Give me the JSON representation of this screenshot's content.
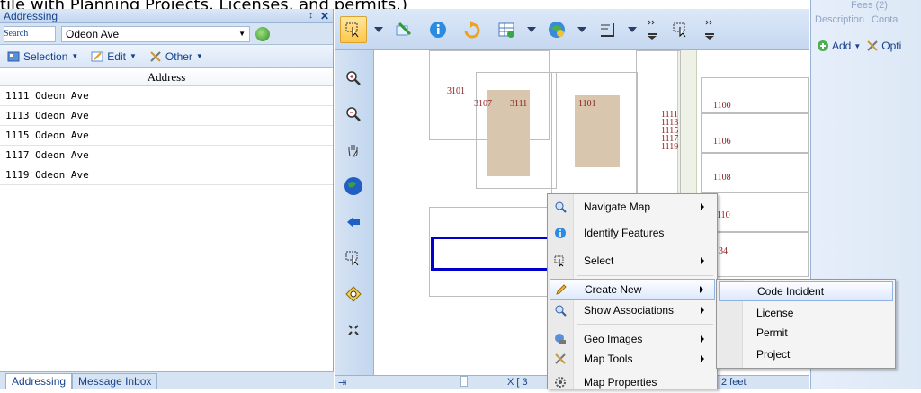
{
  "banner": "tile with Planning Projects, Licenses, and permits.)",
  "addressing": {
    "title": "Addressing",
    "pin": "↕",
    "close": "✕",
    "search_label": "Search",
    "search_value": "Odeon Ave",
    "toolbar": {
      "selection": "Selection",
      "edit": "Edit",
      "other": "Other"
    },
    "column_header": "Address",
    "rows": [
      "1111 Odeon Ave",
      "1113 Odeon Ave",
      "1115 Odeon Ave",
      "1117 Odeon Ave",
      "1119 Odeon Ave"
    ],
    "tabs": [
      "Addressing",
      "Message Inbox"
    ]
  },
  "map": {
    "labels": [
      {
        "t": "3101"
      },
      {
        "t": "3107"
      },
      {
        "t": "3111"
      },
      {
        "t": "1101"
      },
      {
        "t": "1111"
      },
      {
        "t": "1113"
      },
      {
        "t": "1115"
      },
      {
        "t": "1117"
      },
      {
        "t": "1119"
      },
      {
        "t": "1100"
      },
      {
        "t": "1106"
      },
      {
        "t": "1108"
      },
      {
        "t": "110"
      },
      {
        "t": "34"
      }
    ],
    "bottom_text_left": "X [ 3",
    "bottom_text_right": "2 feet"
  },
  "context_menu": {
    "items": [
      {
        "label": "Navigate Map",
        "submenu": true
      },
      {
        "label": "Identify Features",
        "submenu": false
      },
      {
        "label": "Select",
        "submenu": true
      },
      {
        "label": "Create New",
        "submenu": true
      },
      {
        "label": "Show Associations",
        "submenu": true
      },
      {
        "label": "Geo Images",
        "submenu": true
      },
      {
        "label": "Map Tools",
        "submenu": true
      },
      {
        "label": "Map Properties",
        "submenu": false
      }
    ]
  },
  "submenu": {
    "items": [
      "Code Incident",
      "License",
      "Permit",
      "Project"
    ]
  },
  "right_panel": {
    "fees": "Fees (2)",
    "tabs": [
      "Description",
      "Conta"
    ],
    "add": "Add",
    "opt": "Opti"
  },
  "colors": {
    "accent": "#15428b",
    "selected_parcel": "#0000cc",
    "highlight": "#dce9fb"
  }
}
